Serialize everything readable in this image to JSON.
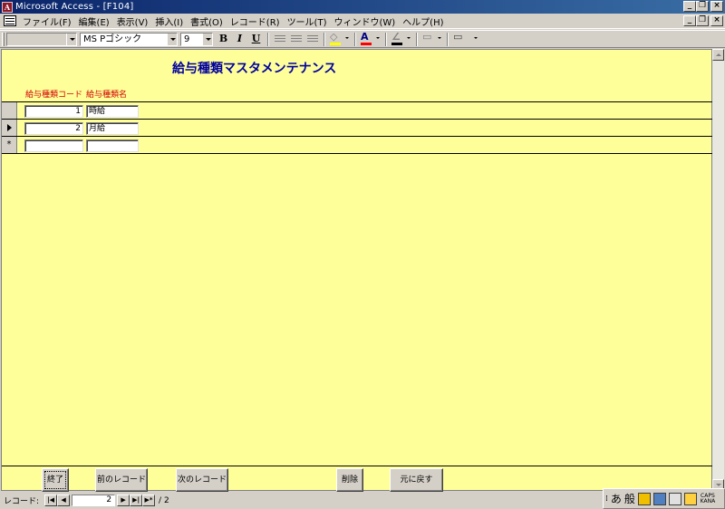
{
  "window": {
    "title": "Microsoft Access - [F104]",
    "app_icon_glyph": "A"
  },
  "menu": {
    "items": [
      "ファイル(F)",
      "編集(E)",
      "表示(V)",
      "挿入(I)",
      "書式(O)",
      "レコード(R)",
      "ツール(T)",
      "ウィンドウ(W)",
      "ヘルプ(H)"
    ]
  },
  "toolbar": {
    "object_combo": "",
    "font_name": "MS Pゴシック",
    "font_size": "9",
    "bold": "B",
    "italic": "I",
    "underline": "U",
    "fill_glyph": "◇",
    "font_color_glyph": "A",
    "line_color_glyph": "∠",
    "colors": {
      "fill": "#ffff00",
      "font": "#ff0000",
      "line": "#000000"
    }
  },
  "form": {
    "title": "給与種類マスタメンテナンス",
    "columns": [
      "給与種類コード",
      "給与種類名"
    ],
    "rows": [
      {
        "code": "1",
        "name": "時給",
        "selector": ""
      },
      {
        "code": "2",
        "name": "月給",
        "selector": "current"
      },
      {
        "code": "",
        "name": "",
        "selector": "*"
      }
    ],
    "buttons": [
      "終了",
      "前のレコード",
      "次のレコード",
      "削除",
      "元に戻す"
    ],
    "colors": {
      "background": "#ffff99",
      "title": "#0000a0",
      "labels": "#d00000"
    }
  },
  "navigation": {
    "label": "レコード:",
    "current": "2",
    "total": "/ 2",
    "first": "|◀",
    "prev": "◀",
    "next": "▶",
    "last": "▶|",
    "new": "▶*"
  },
  "ime": {
    "mode": "あ",
    "kanji": "般",
    "caps": "CAPS",
    "kana": "KANA"
  }
}
